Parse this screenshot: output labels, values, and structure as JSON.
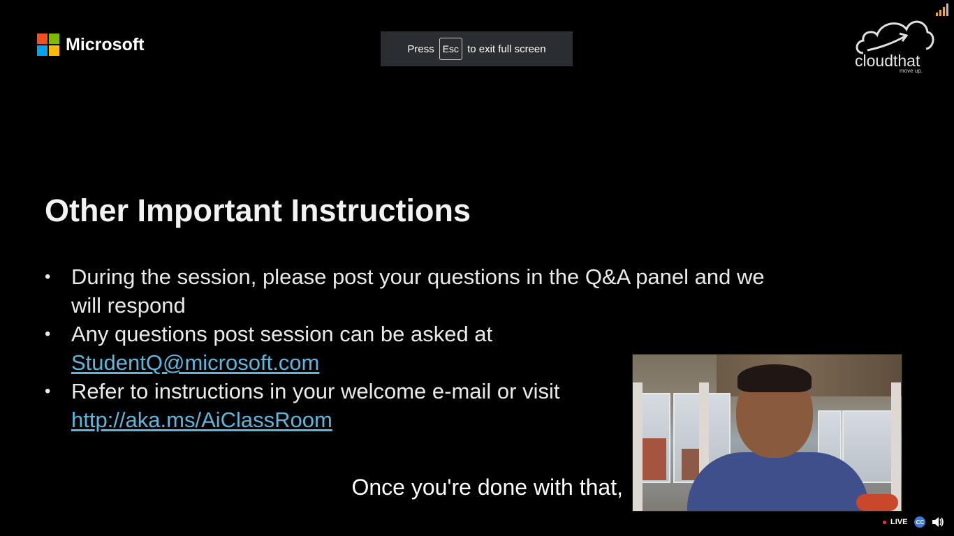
{
  "slide": {
    "brand": "Microsoft",
    "title": "Other Important Instructions",
    "bullets": [
      {
        "text": "During the session, please post your questions in the Q&A panel and we will respond",
        "link": ""
      },
      {
        "text": "Any questions post session can be asked at",
        "link": "StudentQ@microsoft.com"
      },
      {
        "text": "Refer to instructions in your welcome e-mail or visit",
        "link": "http://aka.ms/AiClassRoom"
      }
    ]
  },
  "logos": {
    "microsoft_colors": [
      "#f25022",
      "#7fba00",
      "#00a4ef",
      "#ffb900"
    ],
    "cloudthat_name": "cloudthat",
    "cloudthat_tagline": "move up."
  },
  "fullscreen_toast": {
    "press": "Press",
    "key": "Esc",
    "rest": "to exit full screen"
  },
  "caption": "Once you're done with that,",
  "player": {
    "live_label": "LIVE",
    "cc_label": "CC",
    "signal_icon": "signal-strength-icon",
    "volume_icon": "volume-icon"
  },
  "colors": {
    "link": "#5fb6dd",
    "toast_bg": "#2a2d31",
    "live_dot": "#e53935",
    "signal": "#f0a63a"
  }
}
